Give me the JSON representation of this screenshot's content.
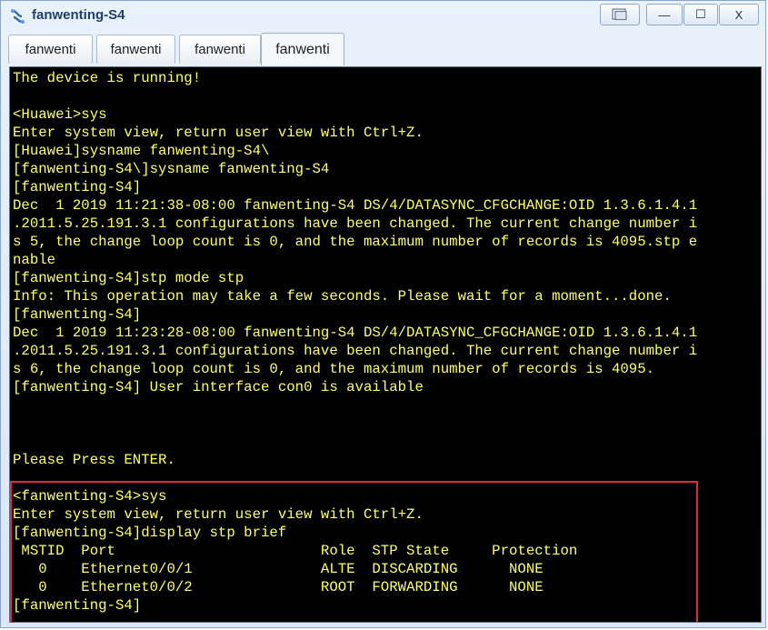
{
  "window": {
    "title": "fanwenting-S4",
    "controls": {
      "minimize": "—",
      "maximize": "☐",
      "close": "X"
    }
  },
  "tabs": [
    {
      "label": "fanwenti"
    },
    {
      "label": "fanwenti"
    },
    {
      "label": "fanwenti"
    },
    {
      "label": "fanwenti"
    }
  ],
  "console": {
    "lines": [
      "The device is running!",
      "",
      "<Huawei>sys",
      "Enter system view, return user view with Ctrl+Z.",
      "[Huawei]sysname fanwenting-S4\\",
      "[fanwenting-S4\\]sysname fanwenting-S4",
      "[fanwenting-S4]",
      "Dec  1 2019 11:21:38-08:00 fanwenting-S4 DS/4/DATASYNC_CFGCHANGE:OID 1.3.6.1.4.1",
      ".2011.5.25.191.3.1 configurations have been changed. The current change number i",
      "s 5, the change loop count is 0, and the maximum number of records is 4095.stp e",
      "nable",
      "[fanwenting-S4]stp mode stp",
      "Info: This operation may take a few seconds. Please wait for a moment...done.",
      "[fanwenting-S4]",
      "Dec  1 2019 11:23:28-08:00 fanwenting-S4 DS/4/DATASYNC_CFGCHANGE:OID 1.3.6.1.4.1",
      ".2011.5.25.191.3.1 configurations have been changed. The current change number i",
      "s 6, the change loop count is 0, and the maximum number of records is 4095.",
      "[fanwenting-S4] User interface con0 is available",
      "",
      "",
      "",
      "Please Press ENTER.",
      "",
      "<fanwenting-S4>sys",
      "Enter system view, return user view with Ctrl+Z.",
      "[fanwenting-S4]display stp brief",
      " MSTID  Port                        Role  STP State     Protection",
      "   0    Ethernet0/0/1               ALTE  DISCARDING      NONE",
      "   0    Ethernet0/0/2               ROOT  FORWARDING      NONE",
      "[fanwenting-S4]"
    ]
  },
  "colors": {
    "console_bg": "#000000",
    "console_text": "#ffff66",
    "highlight": "#e0293a"
  }
}
